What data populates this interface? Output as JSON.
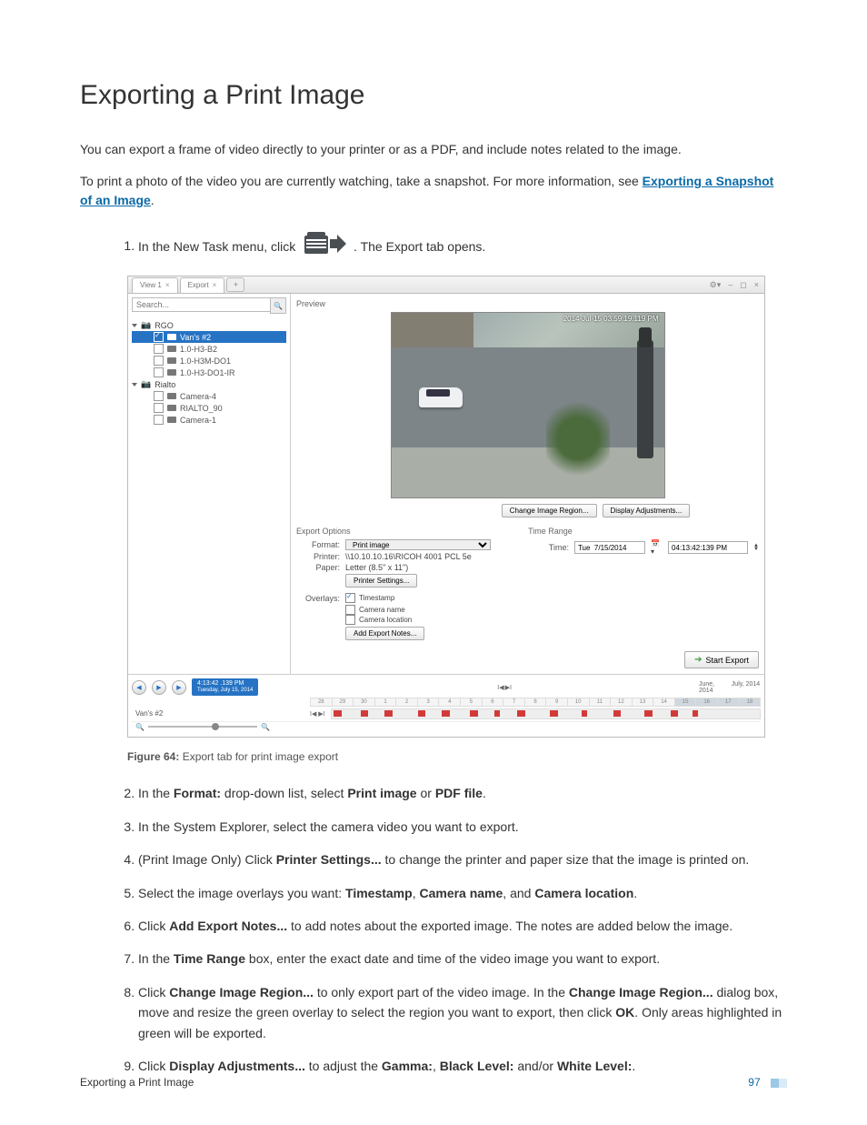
{
  "title": "Exporting a Print Image",
  "intro": "You can export a frame of video directly to your printer or as a PDF, and include notes related to the image.",
  "intro2_a": "To print a photo of the video you are currently watching, take a snapshot. For more information, see ",
  "intro2_link": "Exporting a Snapshot of an Image",
  "step1_a": "In the New Task menu, click ",
  "step1_b": ". The Export tab opens.",
  "figure_label": "Figure 64:",
  "figure_text": " Export tab for print image export",
  "step2": {
    "a": "In the ",
    "b": "Format:",
    "c": " drop-down list, select ",
    "d": "Print image",
    "e": " or ",
    "f": "PDF file",
    "g": "."
  },
  "step3": "In the System Explorer, select the camera video you want to export.",
  "step4": {
    "a": "(Print Image Only) Click ",
    "b": "Printer Settings...",
    "c": " to change the printer and paper size that the image is printed on."
  },
  "step5": {
    "a": "Select the image overlays you want: ",
    "b": "Timestamp",
    "c": ", ",
    "d": "Camera name",
    "e": ", and ",
    "f": "Camera location",
    "g": "."
  },
  "step6": {
    "a": "Click ",
    "b": "Add Export Notes...",
    "c": " to add notes about the exported image. The notes are added below the image."
  },
  "step7": {
    "a": "In the ",
    "b": "Time Range",
    "c": " box, enter the exact date and time of the video image you want to export."
  },
  "step8": {
    "a": "Click ",
    "b": "Change Image Region...",
    "c": " to only export part of the video image. In the ",
    "d": "Change Image Region...",
    "e": " dialog box, move and resize the green overlay to select the region you want to export, then click ",
    "f": "OK",
    "g": ". Only areas highlighted in green will be exported."
  },
  "step9": {
    "a": "Click ",
    "b": "Display Adjustments...",
    "c": " to adjust the ",
    "d": "Gamma:",
    "e": ", ",
    "f": "Black Level:",
    "g": " and/or ",
    "h": "White Level:",
    "i": "."
  },
  "footer_title": "Exporting a Print Image",
  "page_number": "97",
  "app": {
    "tabs": {
      "view": "View 1",
      "export": "Export",
      "close": "×",
      "add": "+"
    },
    "wincontrols": {
      "gear": "⚙▾",
      "min": "–",
      "max": "◻",
      "close": "×"
    },
    "search_placeholder": "Search...",
    "tree": {
      "site1": "RGO",
      "site2": "Rialto",
      "cams1": [
        "Van's #2",
        "1.0-H3-B2",
        "1.0-H3M-DO1",
        "1.0-H3-DO1-IR"
      ],
      "cams2": [
        "Camera-4",
        "RIALTO_90",
        "Camera-1"
      ]
    },
    "preview_label": "Preview",
    "preview_timestamp": "2014-Jul-15 03:59:19.119 PM",
    "btn_region": "Change Image Region...",
    "btn_display": "Display Adjustments...",
    "export_options_label": "Export Options",
    "time_range_label": "Time Range",
    "format_label": "Format:",
    "format_value": "Print image",
    "printer_label": "Printer:",
    "printer_value": "\\\\10.10.10.16\\RICOH 4001 PCL 5e",
    "paper_label": "Paper:",
    "paper_value": "Letter (8.5\" x 11\")",
    "printer_settings_btn": "Printer Settings...",
    "overlays_label": "Overlays:",
    "overlay_timestamp": "Timestamp",
    "overlay_camname": "Camera name",
    "overlay_camloc": "Camera location",
    "add_notes_btn": "Add Export Notes...",
    "time_label": "Time:",
    "time_date": "Tue  7/15/2014",
    "time_time": "04:13:42:139 PM",
    "start_export": "Start Export",
    "timeline": {
      "clock": "4:13:42 .139 PM",
      "date": "Tuesday, July 15, 2014",
      "month1": "June, 2014",
      "month2": "July, 2014",
      "camera_row": "Van's #2",
      "days": [
        "28",
        "29",
        "30",
        "1",
        "2",
        "3",
        "4",
        "5",
        "6",
        "7",
        "8",
        "9",
        "10",
        "11",
        "12",
        "13",
        "14",
        "15",
        "16",
        "17",
        "18"
      ]
    }
  }
}
